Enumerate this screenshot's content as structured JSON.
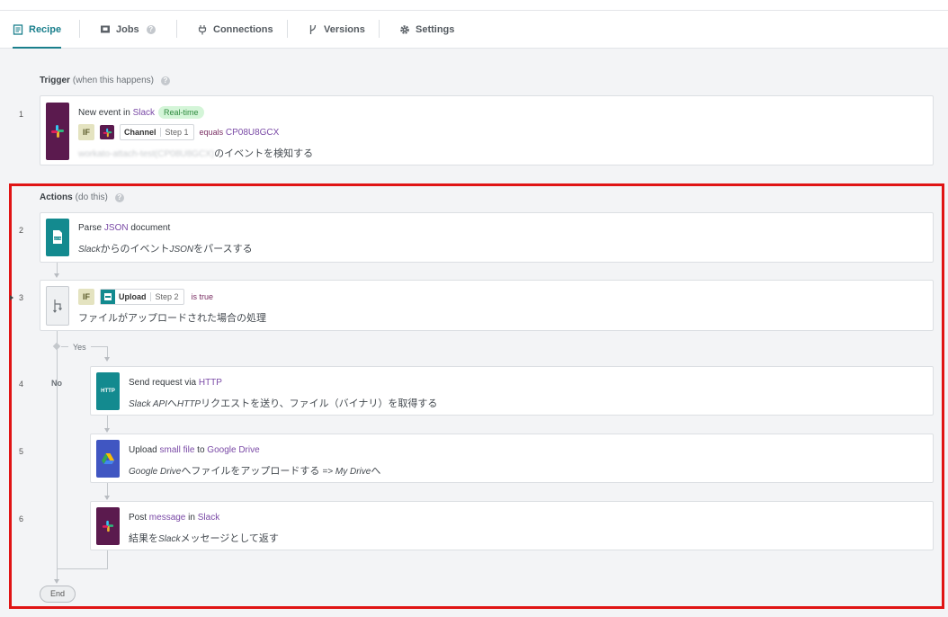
{
  "tabs": [
    {
      "label": "Recipe",
      "icon": "document-icon",
      "active": true
    },
    {
      "label": "Jobs",
      "icon": "flag-icon",
      "help": "?"
    },
    {
      "label": "Connections",
      "icon": "plug-icon"
    },
    {
      "label": "Versions",
      "icon": "branch-icon"
    },
    {
      "label": "Settings",
      "icon": "gear-icon"
    }
  ],
  "trigger_section": {
    "title": "Trigger",
    "subtitle": "(when this happens)",
    "help": "?"
  },
  "actions_section": {
    "title": "Actions",
    "subtitle": "(do this)",
    "help": "?"
  },
  "steps": {
    "s1": {
      "num": "1",
      "pre": "New event in",
      "app": "Slack",
      "badge": "Real-time",
      "if": "IF",
      "pill_name": "Channel",
      "pill_step": "Step 1",
      "op": "equals",
      "value": "CP08U8GCX",
      "desc_blur": "workato-attach-test(CP08U8GCX)",
      "desc": "のイベントを検知する"
    },
    "s2": {
      "num": "2",
      "title_a": "Parse",
      "title_app": "JSON",
      "title_b": "document",
      "desc_i1": "Slack",
      "desc_1": "からのイベント",
      "desc_i2": "JSON",
      "desc_2": "をパースする",
      "icon_text": "JSON"
    },
    "s3": {
      "num": "3",
      "if": "IF",
      "pill_name": "Upload",
      "pill_step": "Step 2",
      "op": "is true",
      "desc": "ファイルがアップロードされた場合の処理"
    },
    "s4": {
      "num": "4",
      "title_a": "Send request via",
      "title_app": "HTTP",
      "desc_i1": "Slack API",
      "desc_1": "へ",
      "desc_i2": "HTTP",
      "desc_2": "リクエストを送り、ファイル（バイナリ）を取得する",
      "icon_text": "HTTP"
    },
    "s5": {
      "num": "5",
      "title_a": "Upload",
      "title_kw": "small file",
      "title_b": "to",
      "title_app": "Google Drive",
      "desc_i1": "Google Drive",
      "desc_1": "へファイルをアップロードする",
      "desc_i2": "=> My Drive",
      "desc_2": "へ"
    },
    "s6": {
      "num": "6",
      "title_a": "Post",
      "title_kw": "message",
      "title_b": "in",
      "title_app": "Slack",
      "desc_1": "結果を",
      "desc_i1": "Slack",
      "desc_2": "メッセージとして返す"
    }
  },
  "branch": {
    "yes": "Yes",
    "no": "No"
  },
  "end_label": "End",
  "colors": {
    "accent": "#1a7f8c",
    "slack": "#5b1a4e",
    "http": "#138a8f",
    "gdrive": "#4056c2",
    "highlight": "#e01414"
  }
}
